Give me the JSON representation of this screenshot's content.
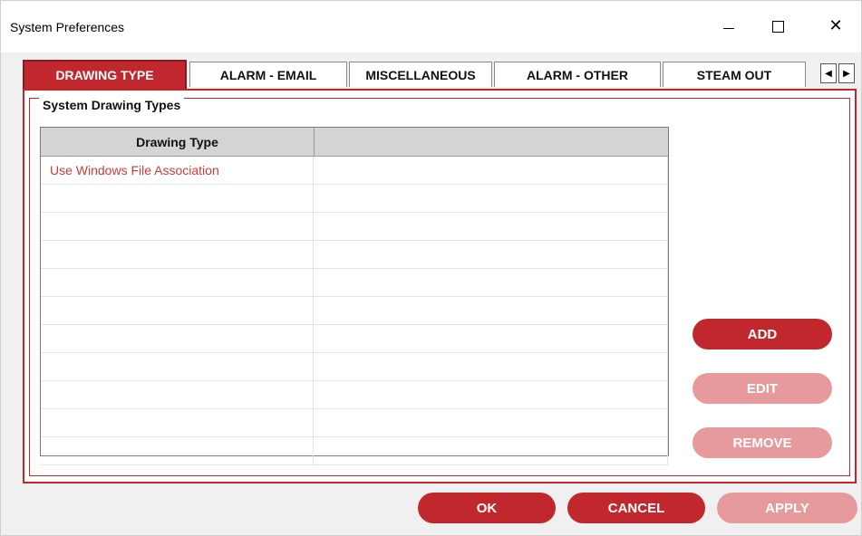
{
  "window": {
    "title": "System Preferences"
  },
  "tabs": [
    {
      "label": "DRAWING TYPE",
      "active": true
    },
    {
      "label": "ALARM - EMAIL",
      "active": false
    },
    {
      "label": "MISCELLANEOUS",
      "active": false
    },
    {
      "label": "ALARM - OTHER",
      "active": false
    },
    {
      "label": "STEAM OUT",
      "active": false
    }
  ],
  "tab_scroll": {
    "left_icon": "arrow-left-icon",
    "right_icon": "arrow-right-icon"
  },
  "group": {
    "title": "System Drawing Types"
  },
  "grid": {
    "columns": [
      "Drawing Type",
      ""
    ],
    "rows": [
      [
        "Use Windows File Association",
        ""
      ],
      [
        "",
        ""
      ],
      [
        "",
        ""
      ],
      [
        "",
        ""
      ],
      [
        "",
        ""
      ],
      [
        "",
        ""
      ],
      [
        "",
        ""
      ],
      [
        "",
        ""
      ],
      [
        "",
        ""
      ],
      [
        "",
        ""
      ],
      [
        "",
        ""
      ]
    ]
  },
  "actions": {
    "add": "ADD",
    "edit": "EDIT",
    "remove": "REMOVE"
  },
  "footer": {
    "ok": "OK",
    "cancel": "CANCEL",
    "apply": "APPLY"
  },
  "colors": {
    "accent": "#c0282d",
    "disabled": "#e79a9c"
  }
}
